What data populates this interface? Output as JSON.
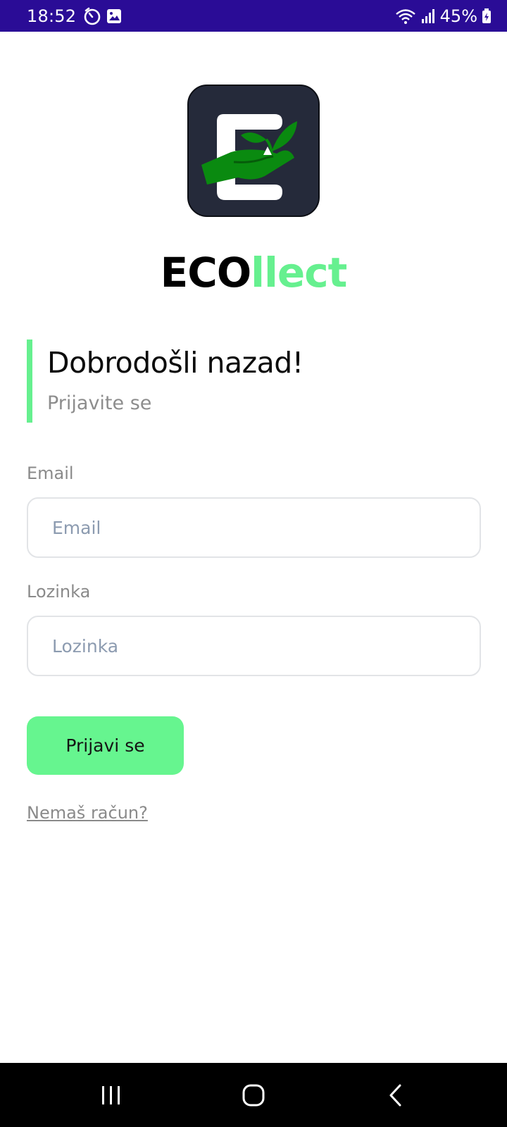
{
  "status_bar": {
    "time": "18:52",
    "battery": "45%",
    "icons": [
      "timer-icon",
      "gallery-icon",
      "wifi-icon",
      "signal-icon",
      "battery-icon"
    ]
  },
  "brand": {
    "part1": "ECO",
    "part2": "llect",
    "color_dark": "#000000",
    "color_accent": "#66f08f"
  },
  "welcome": {
    "title": "Dobrodošli nazad!",
    "subtitle": "Prijavite se"
  },
  "form": {
    "email_label": "Email",
    "email_placeholder": "Email",
    "email_value": "",
    "password_label": "Lozinka",
    "password_placeholder": "Lozinka",
    "password_value": "",
    "submit_label": "Prijavi se",
    "register_link": "Nemaš račun?"
  },
  "nav": {
    "icons": [
      "recents-icon",
      "home-icon",
      "back-icon"
    ]
  }
}
